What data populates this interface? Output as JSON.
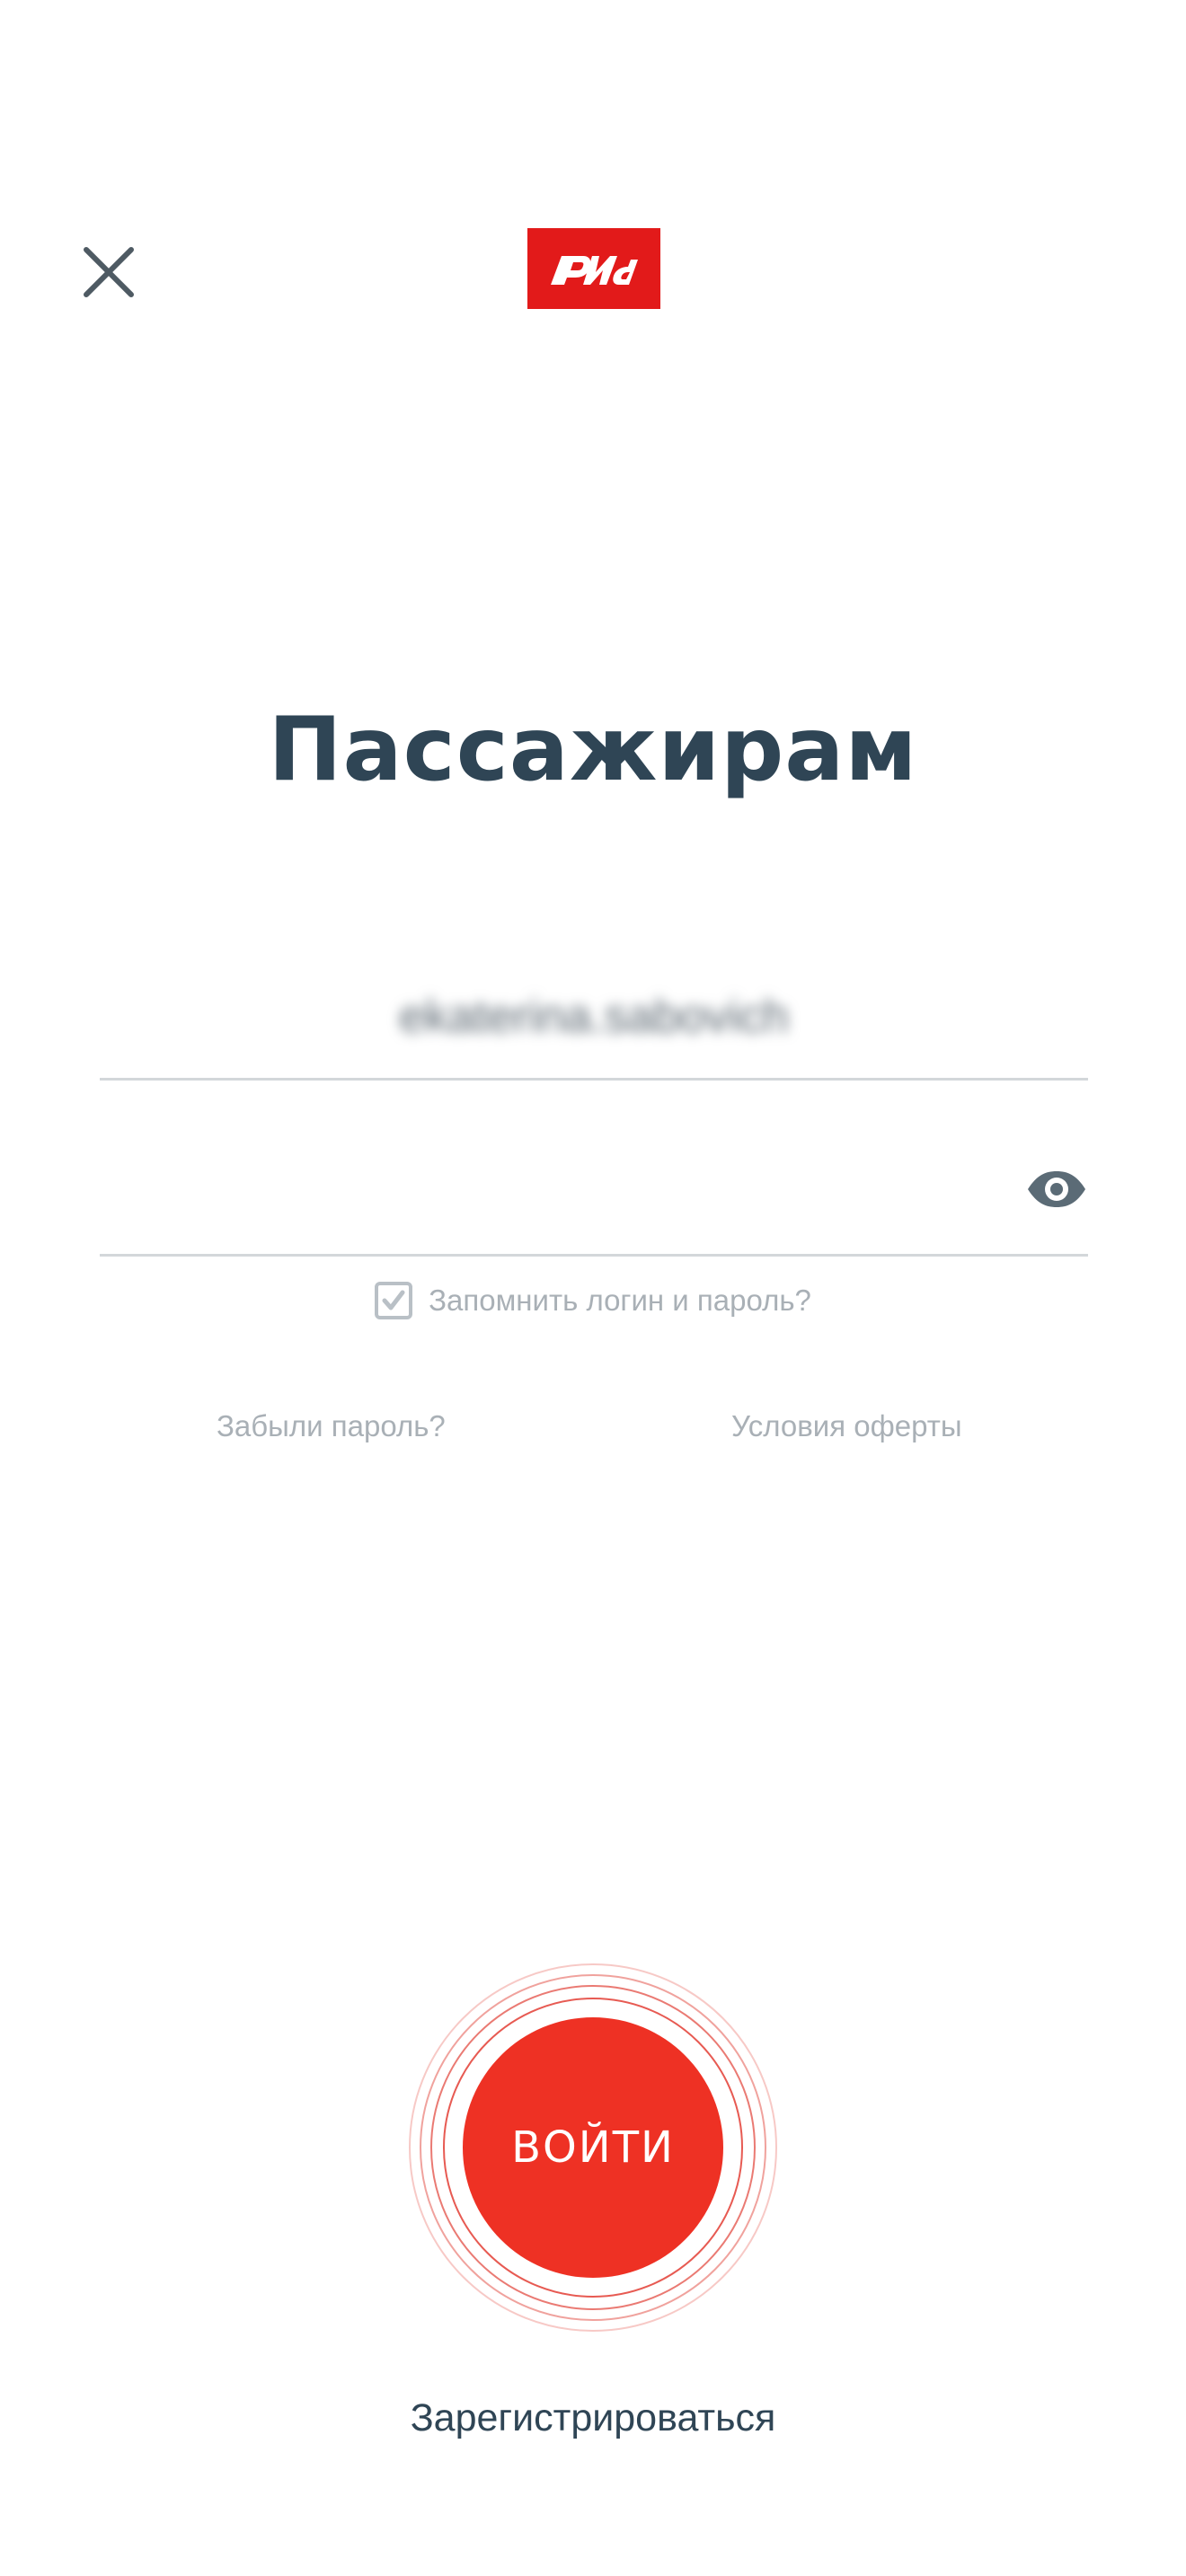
{
  "header": {
    "close_icon": "close-icon",
    "logo_text": "РЖД",
    "logo_color": "#e21a1a"
  },
  "main": {
    "title": "Пассажирам",
    "login_value": "ekaterina.sabovich",
    "eye_icon": "eye-icon",
    "remember_label": "Запомнить логин и пароль?",
    "remember_checked": true,
    "forgot_password_label": "Забыли пароль?",
    "offer_terms_label": "Условия оферты"
  },
  "actions": {
    "login_label": "ВОЙТИ",
    "login_color": "#ee3124",
    "register_label": "Зарегистрироваться"
  }
}
